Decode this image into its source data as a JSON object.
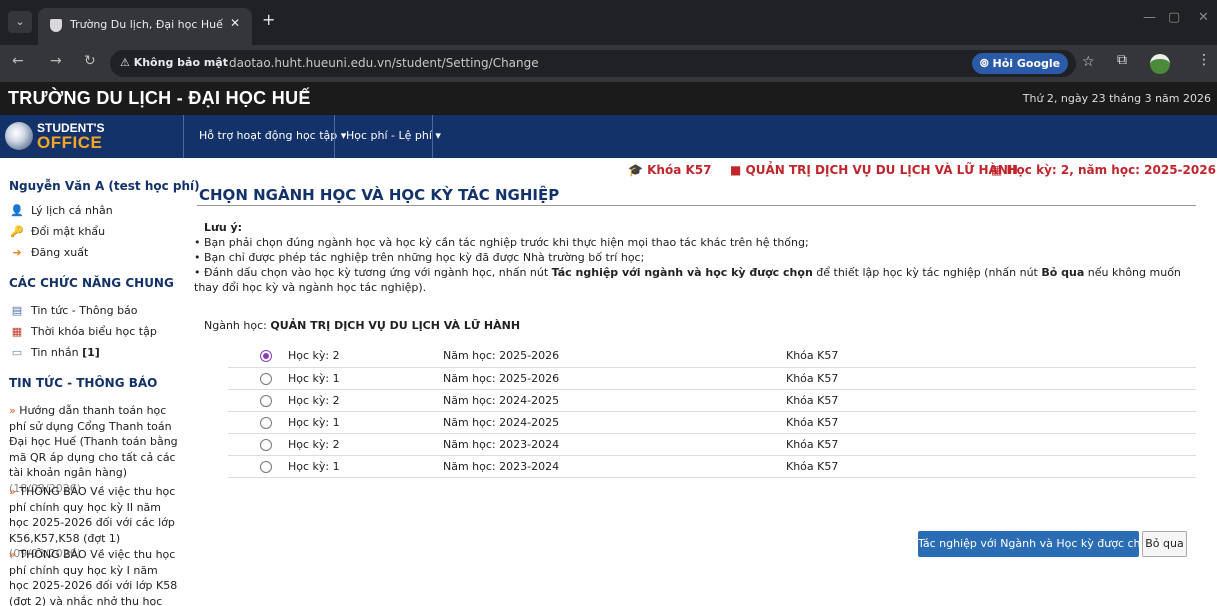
{
  "browser": {
    "tab_title": "Trường Du lịch, Đại học Huế",
    "security_label": "Không bảo mật",
    "url": "daotao.huht.hueuni.edu.vn/student/Setting/Change",
    "ask_google": "Hỏi Google"
  },
  "header": {
    "school_name": "TRƯỜNG DU LỊCH - ĐẠI HỌC HUẾ",
    "date": "Thứ 2, ngày 23 tháng 3 năm 2026",
    "logo_line1": "STUDENT'S",
    "logo_line2": "OFFICE"
  },
  "nav": {
    "menu1": "Hỗ trợ hoạt động học tập ▾",
    "menu2": "Học phí - Lệ phí ▾"
  },
  "info": {
    "cohort": "Khóa K57",
    "program": "QUẢN TRỊ DỊCH VỤ DU LỊCH VÀ LỮ HÀNH",
    "semester": "Học kỳ: 2, năm học: 2025-2026"
  },
  "sidebar": {
    "user_name": "Nguyễn Văn A (test học phí)",
    "profile": "Lý lịch cá nhân",
    "change_password": "Đổi mật khẩu",
    "logout": "Đăng xuất",
    "common_heading": "CÁC CHỨC NĂNG CHUNG",
    "news_link": "Tin tức - Thông báo",
    "timetable_link": "Thời khóa biểu học tập",
    "messages_link": "Tin nhắn",
    "messages_count": "[1]",
    "news_heading": "TIN TỨC - THÔNG BÁO",
    "news": [
      {
        "text": "Hướng dẫn thanh toán học phí sử dụng Cổng Thanh toán Đại học Huế (Thanh toán bằng mã QR áp dụng cho tất cả các tài khoản ngân hàng)",
        "date": "(18/03/2026)"
      },
      {
        "text": "THÔNG BÁO Về việc thu học phí chính quy học kỳ II năm học 2025-2026 đối với các lớp K56,K57,K58 (đợt 1)",
        "date": "(09/03/2026)"
      },
      {
        "text": "THÔNG BÁO Về việc thu học phí chính quy học kỳ I năm học 2025-2026 đối với lớp K58 (đợt 2) và nhắc nhở thu học phí của các khóa"
      }
    ]
  },
  "main": {
    "title": "CHỌN NGÀNH HỌC VÀ HỌC KỲ TÁC NGHIỆP",
    "note_heading": "Lưu ý:",
    "note1": "• Bạn phải chọn đúng ngành học và học kỳ cần tác nghiệp trước khi thực hiện mọi thao tác khác trên hệ thống;",
    "note2": "• Bạn chỉ được phép tác nghiệp trên những học kỳ đã được Nhà trường bố trí học;",
    "note3a": "• Đánh dấu chọn vào học kỳ tương ứng với ngành học, nhấn nút ",
    "note3b": "Tác nghiệp với ngành và học kỳ được chọn",
    "note3c": " để thiết lập học kỳ tác nghiệp (nhấn nút ",
    "note3d": "Bỏ qua",
    "note3e": " nếu không muốn thay đổi học kỳ và ngành học tác nghiệp).",
    "major_label": "Ngành học: ",
    "major_value": "QUẢN TRỊ DỊCH VỤ DU LỊCH VÀ LỮ HÀNH",
    "semesters": [
      {
        "semester": "Học kỳ: 2",
        "year": "Năm học: 2025-2026",
        "cohort": "Khóa K57",
        "selected": true
      },
      {
        "semester": "Học kỳ: 1",
        "year": "Năm học: 2025-2026",
        "cohort": "Khóa K57",
        "selected": false
      },
      {
        "semester": "Học kỳ: 2",
        "year": "Năm học: 2024-2025",
        "cohort": "Khóa K57",
        "selected": false
      },
      {
        "semester": "Học kỳ: 1",
        "year": "Năm học: 2024-2025",
        "cohort": "Khóa K57",
        "selected": false
      },
      {
        "semester": "Học kỳ: 2",
        "year": "Năm học: 2023-2024",
        "cohort": "Khóa K57",
        "selected": false
      },
      {
        "semester": "Học kỳ: 1",
        "year": "Năm học: 2023-2024",
        "cohort": "Khóa K57",
        "selected": false
      }
    ],
    "confirm_button": "Tác nghiệp với Ngành và Học kỳ được chọn",
    "skip_button": "Bỏ qua"
  }
}
